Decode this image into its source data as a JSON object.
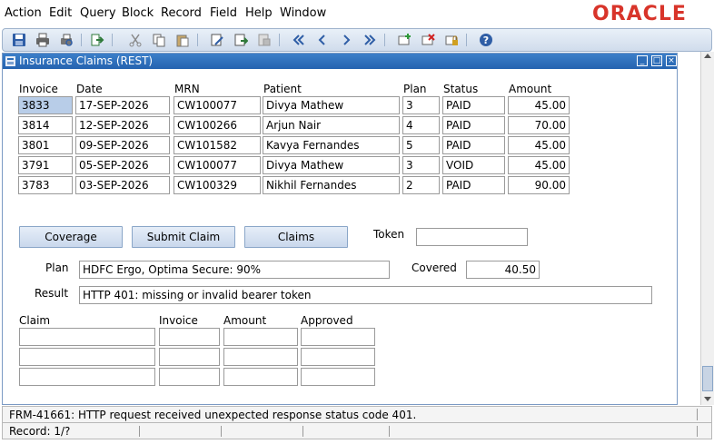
{
  "menu": [
    "Action",
    "Edit",
    "Query",
    "Block",
    "Record",
    "Field",
    "Help",
    "Window"
  ],
  "brand": "ORACLE",
  "colors": {
    "brand": "#d8342a",
    "title_bar": "#2d6db8",
    "button": "#c9d8ec",
    "selected_cell": "#b8cde8"
  },
  "toolbar": {
    "icons": [
      "save-icon",
      "print-icon",
      "print-preview-icon",
      "exit-icon",
      "cut-icon",
      "copy-icon",
      "paste-icon",
      "edit-icon",
      "export-icon",
      "attachment-icon",
      "first-record-icon",
      "previous-record-icon",
      "next-record-icon",
      "last-record-icon",
      "insert-record-icon",
      "delete-record-icon",
      "lock-record-icon",
      "help-icon"
    ]
  },
  "window": {
    "title": "Insurance Claims (REST)"
  },
  "table": {
    "headers": [
      "Invoice",
      "Date",
      "MRN",
      "Patient",
      "Plan",
      "Status",
      "Amount"
    ],
    "rows": [
      [
        "3833",
        "17-SEP-2026",
        "CW100077",
        "Divya Mathew",
        "3",
        "PAID",
        "45.00"
      ],
      [
        "3814",
        "12-SEP-2026",
        "CW100266",
        "Arjun Nair",
        "4",
        "PAID",
        "70.00"
      ],
      [
        "3801",
        "09-SEP-2026",
        "CW101582",
        "Kavya Fernandes",
        "5",
        "PAID",
        "45.00"
      ],
      [
        "3791",
        "05-SEP-2026",
        "CW100077",
        "Divya Mathew",
        "3",
        "VOID",
        "45.00"
      ],
      [
        "3783",
        "03-SEP-2026",
        "CW100329",
        "Nikhil Fernandes",
        "2",
        "PAID",
        "90.00"
      ]
    ]
  },
  "buttons": {
    "coverage": "Coverage",
    "submit_claim": "Submit Claim",
    "claims": "Claims"
  },
  "token": {
    "label": "Token",
    "value": ""
  },
  "plan": {
    "label": "Plan",
    "value": "HDFC Ergo, Optima Secure: 90%"
  },
  "covered": {
    "label": "Covered",
    "value": "40.50"
  },
  "result": {
    "label": "Result",
    "value": "HTTP 401: missing or invalid bearer token"
  },
  "claims_table": {
    "headers": [
      "Claim",
      "Invoice",
      "Amount",
      "Approved"
    ]
  },
  "status": {
    "message": "FRM-41661: HTTP request received unexpected response status code 401.",
    "record": "Record: 1/?"
  }
}
